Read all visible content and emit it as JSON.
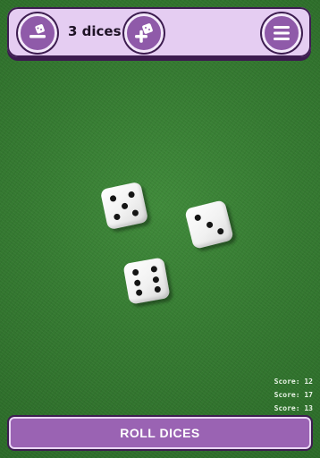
{
  "header": {
    "dice_count_label": "3 dices",
    "remove_icon": "remove-die-icon",
    "add_icon": "add-die-icon",
    "menu_icon": "hamburger-menu-icon"
  },
  "dice": [
    {
      "value": 5
    },
    {
      "value": 3
    },
    {
      "value": 6
    }
  ],
  "scores": [
    "Score: 12",
    "Score: 17",
    "Score: 13"
  ],
  "roll_button": {
    "label": "ROLL DICES"
  },
  "colors": {
    "panel": "#e5cdf2",
    "button": "#9a63b3",
    "table": "#357a31"
  }
}
